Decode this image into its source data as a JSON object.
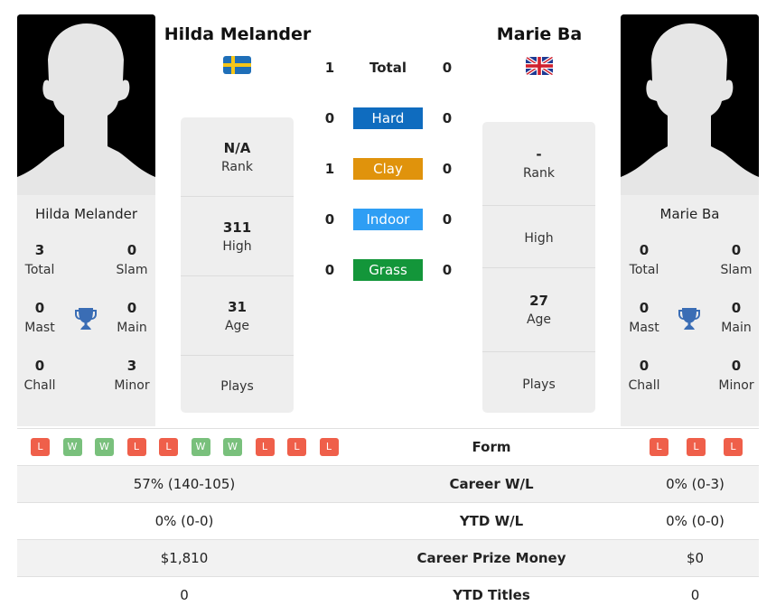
{
  "colors": {
    "hard": "#0f6cbf",
    "clay": "#e0930c",
    "indoor": "#2e9ef4",
    "grass": "#13963a",
    "loss": "#ef5f4a",
    "win": "#79c07c",
    "trophy": "#3a6db5"
  },
  "player1": {
    "name": "Hilda Melander",
    "flag": "sweden-flag",
    "titles": {
      "total": {
        "value": "3",
        "label": "Total"
      },
      "slam": {
        "value": "0",
        "label": "Slam"
      },
      "mast": {
        "value": "0",
        "label": "Mast"
      },
      "main": {
        "value": "0",
        "label": "Main"
      },
      "chall": {
        "value": "0",
        "label": "Chall"
      },
      "minor": {
        "value": "3",
        "label": "Minor"
      }
    },
    "rank": {
      "value": "N/A",
      "label": "Rank"
    },
    "high": {
      "value": "311",
      "label": "High"
    },
    "age": {
      "value": "31",
      "label": "Age"
    },
    "plays": {
      "value": "",
      "label": "Plays"
    },
    "form": [
      "L",
      "W",
      "W",
      "L",
      "L",
      "W",
      "W",
      "L",
      "L",
      "L"
    ],
    "career_wl": "57% (140-105)",
    "ytd_wl": "0% (0-0)",
    "prize_money": "$1,810",
    "ytd_titles": "0"
  },
  "player2": {
    "name": "Marie Ba",
    "flag": "uk-flag",
    "titles": {
      "total": {
        "value": "0",
        "label": "Total"
      },
      "slam": {
        "value": "0",
        "label": "Slam"
      },
      "mast": {
        "value": "0",
        "label": "Mast"
      },
      "main": {
        "value": "0",
        "label": "Main"
      },
      "chall": {
        "value": "0",
        "label": "Chall"
      },
      "minor": {
        "value": "0",
        "label": "Minor"
      }
    },
    "rank": {
      "value": "-",
      "label": "Rank"
    },
    "high": {
      "value": "",
      "label": "High"
    },
    "age": {
      "value": "27",
      "label": "Age"
    },
    "plays": {
      "value": "",
      "label": "Plays"
    },
    "form": [
      "L",
      "L",
      "L"
    ],
    "career_wl": "0% (0-3)",
    "ytd_wl": "0% (0-0)",
    "prize_money": "$0",
    "ytd_titles": "0"
  },
  "h2h": {
    "total": {
      "label": "Total",
      "p1": "1",
      "p2": "0"
    },
    "hard": {
      "label": "Hard",
      "p1": "0",
      "p2": "0"
    },
    "clay": {
      "label": "Clay",
      "p1": "1",
      "p2": "0"
    },
    "indoor": {
      "label": "Indoor",
      "p1": "0",
      "p2": "0"
    },
    "grass": {
      "label": "Grass",
      "p1": "0",
      "p2": "0"
    }
  },
  "table_labels": {
    "form": "Form",
    "career_wl": "Career W/L",
    "ytd_wl": "YTD W/L",
    "prize_money": "Career Prize Money",
    "ytd_titles": "YTD Titles"
  }
}
